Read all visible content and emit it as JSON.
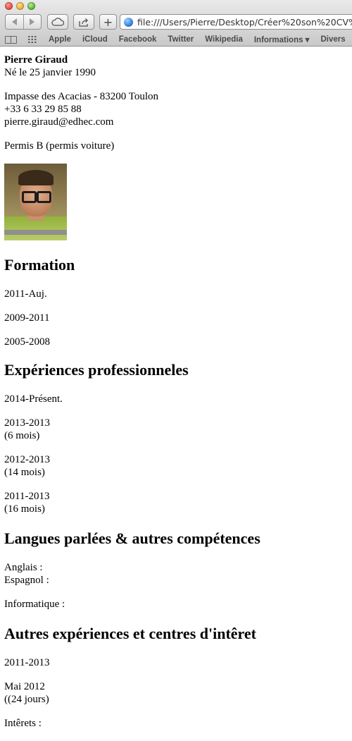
{
  "browser": {
    "url": "file:///Users/Pierre/Desktop/Créer%20son%20CV%20s",
    "bookmarks": [
      "Apple",
      "iCloud",
      "Facebook",
      "Twitter",
      "Wikipedia",
      "Informations ▾",
      "Divers"
    ]
  },
  "cv": {
    "name": "Pierre Giraud",
    "birth": "Né le 25 janvier 1990",
    "address": "Impasse des Acacias - 83200 Toulon",
    "phone": "+33 6 33 29 85 88",
    "email": "pierre.giraud@edhec.com",
    "license": "Permis B (permis voiture)",
    "formation": {
      "title": "Formation",
      "entries": [
        "2011-Auj.",
        "2009-2011",
        "2005-2008"
      ]
    },
    "experiences": {
      "title": "Expériences professionneles",
      "entries": [
        {
          "dates": "2014-Présent.",
          "duration": ""
        },
        {
          "dates": "2013-2013",
          "duration": "(6 mois)"
        },
        {
          "dates": "2012-2013",
          "duration": "(14 mois)"
        },
        {
          "dates": "2011-2013",
          "duration": "(16 mois)"
        }
      ]
    },
    "langues": {
      "title": "Langues parlées & autres compétences",
      "anglais": "Anglais :",
      "espagnol": "Espagnol :",
      "informatique": "Informatique :"
    },
    "autres": {
      "title": "Autres expériences et centres d'intêret",
      "entry1": "2011-2013",
      "entry2_dates": "Mai 2012",
      "entry2_duration": "((24 jours)",
      "interets": "Intêrets :"
    }
  }
}
